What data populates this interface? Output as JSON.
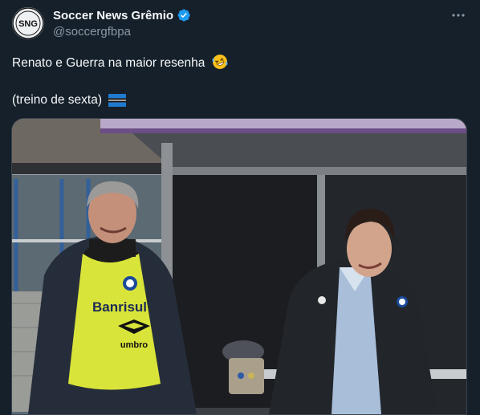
{
  "tweet": {
    "author": {
      "display_name": "Soccer News Grêmio",
      "handle": "@soccergfbpa",
      "avatar_icon": "sng-logo-icon",
      "avatar_text": "SNG",
      "verified_icon": "verified-badge-icon",
      "verified_color": "#1d9bf0"
    },
    "more_icon": "more-options-icon",
    "text": {
      "line1": "Renato e Guerra na maior resenha",
      "line1_emoji": "rolling-on-floor-laughing-emoji",
      "line2": "(treino de sexta)",
      "line2_emoji": "gremio-flag-emoji"
    },
    "media": {
      "type": "photo",
      "vest_text": "Banrisul",
      "vest_brand": "umbro"
    }
  },
  "colors": {
    "background": "#15202b",
    "text_primary": "#f7f9f9",
    "text_secondary": "#8b98a5",
    "border": "#38444d"
  }
}
